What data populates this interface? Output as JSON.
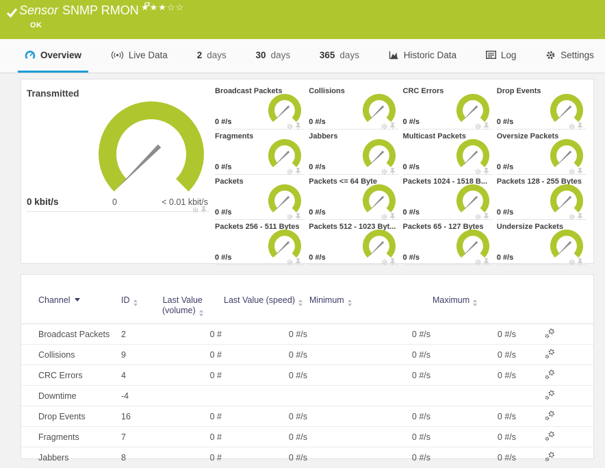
{
  "header": {
    "kind": "Sensor",
    "name": "SNMP RMON",
    "status": "OK",
    "stars": "★★★☆☆"
  },
  "tabs": [
    {
      "label": "Overview"
    },
    {
      "label": "Live Data"
    },
    {
      "num": "2",
      "label": "days"
    },
    {
      "num": "30",
      "label": "days"
    },
    {
      "num": "365",
      "label": "days"
    },
    {
      "label": "Historic Data"
    },
    {
      "label": "Log"
    },
    {
      "label": "Settings"
    }
  ],
  "gauges": {
    "main": {
      "label": "Transmitted",
      "value": "0 kbit/s",
      "tick_min": "0",
      "tick_max": "< 0.01 kbit/s"
    },
    "items": [
      {
        "label": "Broadcast Packets",
        "value": "0 #/s"
      },
      {
        "label": "Collisions",
        "value": "0 #/s"
      },
      {
        "label": "CRC Errors",
        "value": "0 #/s"
      },
      {
        "label": "Drop Events",
        "value": "0 #/s"
      },
      {
        "label": "Fragments",
        "value": "0 #/s"
      },
      {
        "label": "Jabbers",
        "value": "0 #/s"
      },
      {
        "label": "Multicast Packets",
        "value": "0 #/s"
      },
      {
        "label": "Oversize Packets",
        "value": "0 #/s"
      },
      {
        "label": "Packets",
        "value": "0 #/s"
      },
      {
        "label": "Packets <= 64 Byte",
        "value": "0 #/s"
      },
      {
        "label": "Packets 1024 - 1518 B...",
        "value": "0 #/s"
      },
      {
        "label": "Packets 128 - 255 Bytes",
        "value": "0 #/s"
      },
      {
        "label": "Packets 256 - 511 Bytes",
        "value": "0 #/s"
      },
      {
        "label": "Packets 512 - 1023 Byt...",
        "value": "0 #/s"
      },
      {
        "label": "Packets 65 - 127 Bytes",
        "value": "0 #/s"
      },
      {
        "label": "Undersize Packets",
        "value": "0 #/s"
      }
    ]
  },
  "channel_table": {
    "headers": {
      "channel": "Channel",
      "id": "ID",
      "volume_line1": "Last Value",
      "volume_line2": "(volume)",
      "speed": "Last Value (speed)",
      "min": "Minimum",
      "max": "Maximum"
    },
    "rows": [
      {
        "channel": "Broadcast Packets",
        "id": "2",
        "volume": "0 #",
        "speed": "0 #/s",
        "min": "0 #/s",
        "max": "0 #/s"
      },
      {
        "channel": "Collisions",
        "id": "9",
        "volume": "0 #",
        "speed": "0 #/s",
        "min": "0 #/s",
        "max": "0 #/s"
      },
      {
        "channel": "CRC Errors",
        "id": "4",
        "volume": "0 #",
        "speed": "0 #/s",
        "min": "0 #/s",
        "max": "0 #/s"
      },
      {
        "channel": "Downtime",
        "id": "-4",
        "volume": "",
        "speed": "",
        "min": "",
        "max": ""
      },
      {
        "channel": "Drop Events",
        "id": "16",
        "volume": "0 #",
        "speed": "0 #/s",
        "min": "0 #/s",
        "max": "0 #/s"
      },
      {
        "channel": "Fragments",
        "id": "7",
        "volume": "0 #",
        "speed": "0 #/s",
        "min": "0 #/s",
        "max": "0 #/s"
      },
      {
        "channel": "Jabbers",
        "id": "8",
        "volume": "0 #",
        "speed": "0 #/s",
        "min": "0 #/s",
        "max": "0 #/s"
      }
    ]
  },
  "colors": {
    "brand_green": "#b0c62e",
    "accent_blue": "#1e9cd7",
    "needle_gray": "#8c8c8c"
  }
}
